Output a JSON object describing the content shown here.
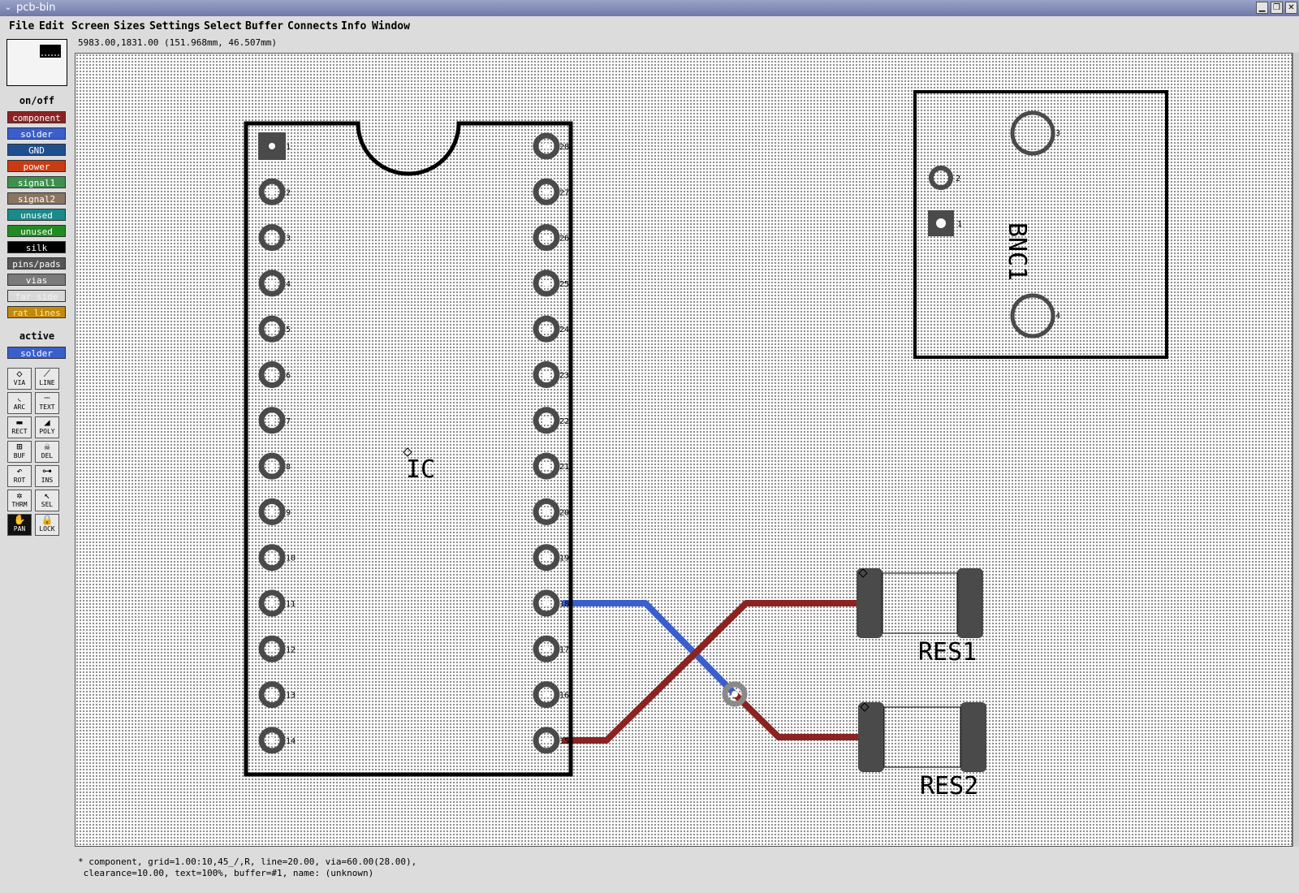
{
  "window": {
    "title": "pcb-bin",
    "menu_glyph": "⌄",
    "minimize": "▁",
    "restore": "❐",
    "close": "✕"
  },
  "menu": [
    "File",
    "Edit",
    "Screen",
    "Sizes",
    "Settings",
    "Select",
    "Buffer",
    "Connects",
    "Info",
    "Window"
  ],
  "coords": "5983.00,1831.00 (151.968mm, 46.507mm)",
  "sidebar": {
    "onoff_label": "on/off",
    "layers": [
      {
        "label": "component",
        "color": "#8b2323"
      },
      {
        "label": "solder",
        "color": "#3a5fcd"
      },
      {
        "label": "GND",
        "color": "#1e4f8f"
      },
      {
        "label": "power",
        "color": "#c83c14"
      },
      {
        "label": "signal1",
        "color": "#3f8f4f"
      },
      {
        "label": "signal2",
        "color": "#8a7560"
      },
      {
        "label": "unused",
        "color": "#1a8a8a"
      },
      {
        "label": "unused",
        "color": "#228b22"
      },
      {
        "label": "silk",
        "color": "#000000"
      },
      {
        "label": "pins/pads",
        "color": "#555555"
      },
      {
        "label": "vias",
        "color": "#7a7a7a"
      },
      {
        "label": "far side",
        "color": "#d8d8d8"
      },
      {
        "label": "rat lines",
        "color": "#c28a0a"
      }
    ],
    "active_label": "active",
    "active_layer": {
      "label": "solder",
      "color": "#3a5fcd"
    },
    "tools": [
      {
        "label": "VIA",
        "icon": "via-icon",
        "glyph": "◇"
      },
      {
        "label": "LINE",
        "icon": "line-icon",
        "glyph": "⟋"
      },
      {
        "label": "ARC",
        "icon": "arc-icon",
        "glyph": "◟"
      },
      {
        "label": "TEXT",
        "icon": "text-icon",
        "glyph": "┄"
      },
      {
        "label": "RECT",
        "icon": "rect-icon",
        "glyph": "▬"
      },
      {
        "label": "POLY",
        "icon": "poly-icon",
        "glyph": "◢"
      },
      {
        "label": "BUF",
        "icon": "buffer-icon",
        "glyph": "⊞"
      },
      {
        "label": "DEL",
        "icon": "delete-icon",
        "glyph": "☠"
      },
      {
        "label": "ROT",
        "icon": "rotate-icon",
        "glyph": "↶"
      },
      {
        "label": "INS",
        "icon": "insert-icon",
        "glyph": "⊶"
      },
      {
        "label": "THRM",
        "icon": "thermal-icon",
        "glyph": "✲"
      },
      {
        "label": "SEL",
        "icon": "select-icon",
        "glyph": "↖"
      },
      {
        "label": "PAN",
        "icon": "pan-icon",
        "glyph": "✋",
        "active": true
      },
      {
        "label": "LOCK",
        "icon": "lock-icon",
        "glyph": "🔒"
      }
    ]
  },
  "board": {
    "ic": {
      "refdes": "IC",
      "left_pins": [
        "1",
        "2",
        "3",
        "4",
        "5",
        "6",
        "7",
        "8",
        "9",
        "10",
        "11",
        "12",
        "13",
        "14"
      ],
      "right_pins": [
        "28",
        "27",
        "26",
        "25",
        "24",
        "23",
        "22",
        "21",
        "20",
        "19",
        "18",
        "17",
        "16",
        "15"
      ]
    },
    "bnc": {
      "refdes": "BNC1",
      "pins": [
        "1",
        "2",
        "3",
        "4"
      ]
    },
    "res1": {
      "refdes": "RES1"
    },
    "res2": {
      "refdes": "RES2"
    }
  },
  "status": {
    "line1": "* component, grid=1.00:10,45_/,R, line=20.00, via=60.00(28.00),",
    "line2": " clearance=10.00, text=100%, buffer=#1, name: (unknown)"
  }
}
